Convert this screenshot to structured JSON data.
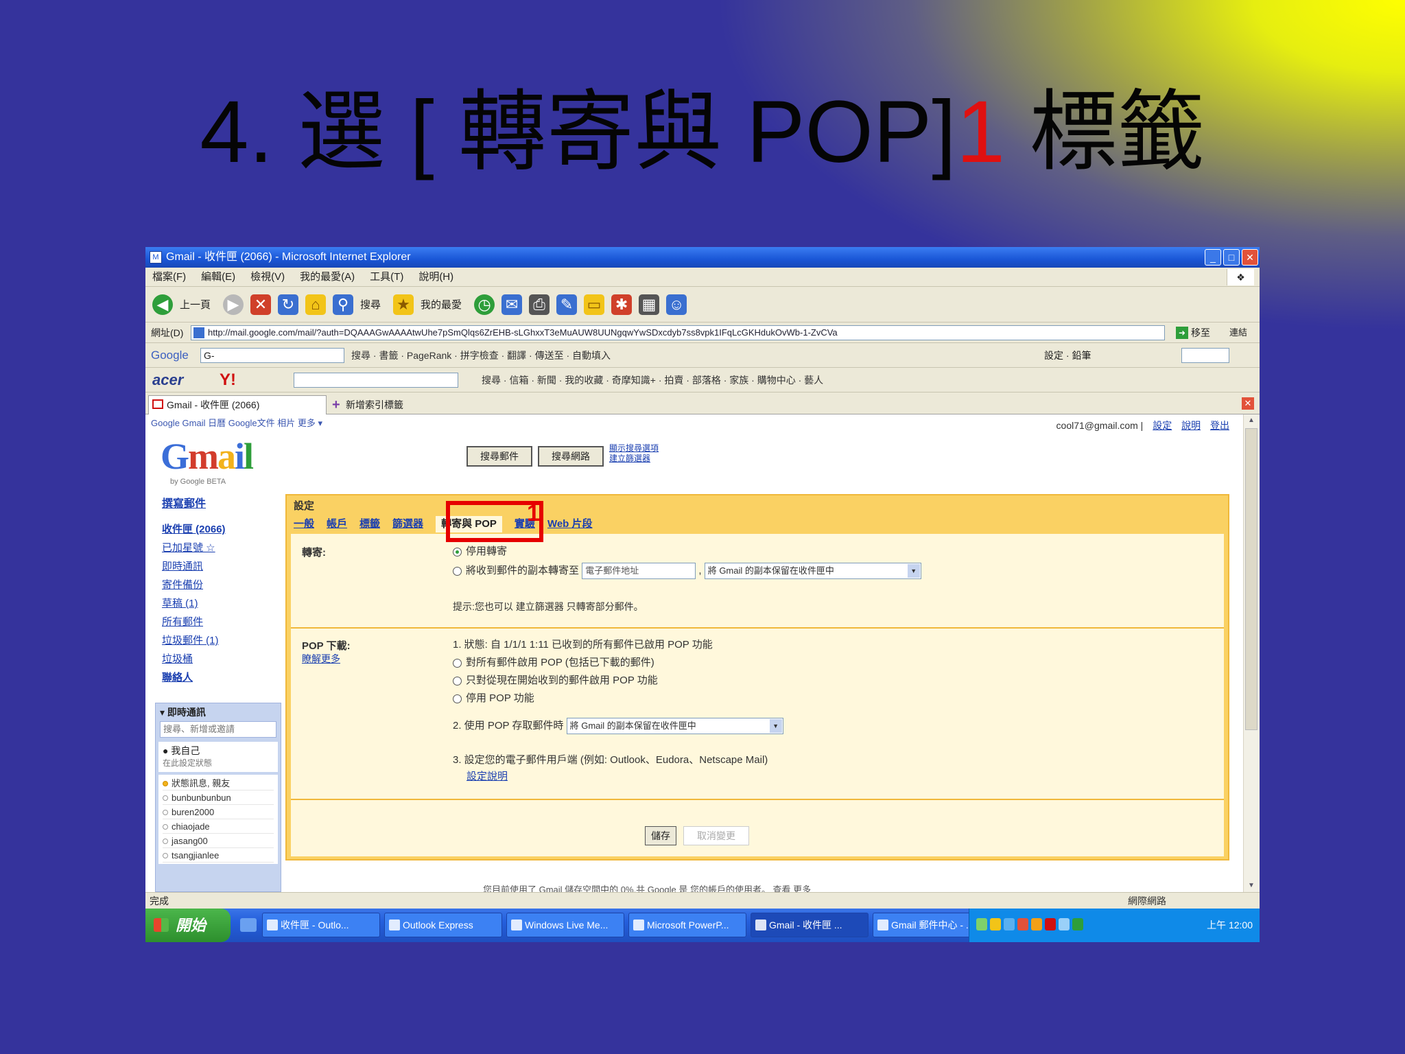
{
  "slide": {
    "title_main": "4. 選 [ 轉寄與 POP]",
    "title_num": "1",
    "title_tail": " 標籤"
  },
  "browser": {
    "window_title": "Gmail - 收件匣 (2066) - Microsoft Internet Explorer",
    "menu": [
      "檔案(F)",
      "編輯(E)",
      "檢視(V)",
      "我的最愛(A)",
      "工具(T)",
      "說明(H)"
    ],
    "toolbar": {
      "back_label": "上一頁",
      "search_label": "搜尋",
      "favorites_label": "我的最愛"
    },
    "address": {
      "label": "網址(D)",
      "url": "http://mail.google.com/mail/?auth=DQAAAGwAAAAtwUhe7pSmQlqs6ZrEHB-sLGhxxT3eMuAUW8UUNgqwYwSDxcdyb7ss8vpk1IFqLcGKHdukOvWb-1-ZvCVa",
      "go_label": "移至",
      "links_label": "連結"
    },
    "google_bar": {
      "logo": "Google",
      "search_value": "G-",
      "tools": "搜尋 · 書籤 · PageRank · 拼字檢查 · 翻譯 · 傳送至 · 自動填入",
      "right_tools": "設定 · 鉛筆"
    },
    "yahoo_bar": {
      "acer": "acer",
      "yahoo": "Y!",
      "tools": "搜尋 · 信箱 · 新聞 · 我的收藏 · 奇摩知識+ · 拍賣 · 部落格 · 家族 · 購物中心 · 藝人"
    },
    "tabs": {
      "active": "Gmail - 收件匣 (2066)",
      "new_tab": "新增索引標籤"
    },
    "status": {
      "left": "完成",
      "right": "網際網路"
    }
  },
  "gmail": {
    "top_links": "Google  Gmail  日曆  Google文件  相片  更多 ▾",
    "account_email": "cool71@gmail.com",
    "account_links": [
      "設定",
      "說明",
      "登出"
    ],
    "logo_parts": [
      "G",
      "m",
      "a",
      "i",
      "l"
    ],
    "logo_sub": "by Google   BETA",
    "search_mail_btn": "搜尋郵件",
    "search_web_btn": "搜尋網路",
    "search_options": "顯示搜尋選項\n建立篩選器",
    "compose": "撰寫郵件",
    "nav": [
      {
        "label": "收件匣 (2066)",
        "bold": true
      },
      {
        "label": "已加星號 ☆",
        "bold": false
      },
      {
        "label": "即時通訊",
        "bold": false
      },
      {
        "label": "寄件備份",
        "bold": false
      },
      {
        "label": "草稿 (1)",
        "bold": false
      },
      {
        "label": "所有郵件",
        "bold": false
      },
      {
        "label": "垃圾郵件 (1)",
        "bold": false
      },
      {
        "label": "垃圾桶",
        "bold": false
      },
      {
        "label": "聯絡人",
        "bold": false
      }
    ],
    "contacts": {
      "header": "▾ 即時通訊",
      "search_placeholder": "搜尋、新增或邀請",
      "me_name": "● 我自己",
      "me_status": "在此設定狀態",
      "items": [
        {
          "name": "狀態訊息, 親友",
          "yellow": true
        },
        {
          "name": "bunbunbunbun",
          "yellow": false
        },
        {
          "name": "buren2000",
          "yellow": false
        },
        {
          "name": "chiaojade",
          "yellow": false
        },
        {
          "name": "jasang00",
          "yellow": false
        },
        {
          "name": "tsangjianlee",
          "yellow": false
        }
      ]
    },
    "settings": {
      "title": "設定",
      "tabs": [
        {
          "label": "一般",
          "active": false
        },
        {
          "label": "帳戶",
          "active": false
        },
        {
          "label": "標籤",
          "active": false
        },
        {
          "label": "篩選器",
          "active": false
        },
        {
          "label": "轉寄與 POP",
          "active": true
        },
        {
          "label": "實驗",
          "active": false
        },
        {
          "label": "Web 片段",
          "active": false
        }
      ],
      "highlight_number": "1",
      "forward": {
        "label": "轉寄:",
        "opt1": "停用轉寄",
        "opt2": "將收到郵件的副本轉寄至",
        "email_placeholder": "電子郵件地址",
        "keep_select": "將 Gmail 的副本保留在收件匣中",
        "tip": "提示:您也可以 建立篩選器 只轉寄部分郵件。",
        "tip_link": "建立篩選器"
      },
      "pop": {
        "label": "POP 下載:",
        "learn_more": "瞭解更多",
        "status_line": "1. 狀態: 自 1/1/1 1:11 已收到的所有郵件已啟用 POP 功能",
        "status_green": "已啟用 POP 功能",
        "opt1": "對所有郵件啟用 POP (包括已下載的郵件)",
        "opt2": "只對從現在開始收到的郵件啟用 POP 功能",
        "opt3": "停用 POP 功能",
        "step2": "2. 使用 POP 存取郵件時",
        "step2_select": "將 Gmail 的副本保留在收件匣中",
        "step3": "3. 設定您的電子郵件用戶端 (例如: Outlook、Eudora、Netscape Mail)",
        "step3_link": "設定說明"
      },
      "save_btn": "儲存",
      "cancel_btn": "取消變更"
    },
    "footer": "您目前使用了 Gmail 儲存空間中的 0%,共 Google 是 您的帳戶的使用者。 查看 更多"
  },
  "taskbar": {
    "start": "開始",
    "tasks": [
      {
        "label": "收件匣 - Outlo...",
        "active": false
      },
      {
        "label": "Outlook Express",
        "active": false
      },
      {
        "label": "Windows Live Me...",
        "active": false
      },
      {
        "label": "Microsoft PowerP...",
        "active": false
      },
      {
        "label": "Gmail - 收件匣 ...",
        "active": true
      },
      {
        "label": "Gmail 郵件中心 - ...",
        "active": false
      }
    ],
    "clock": "上午 12:00"
  }
}
